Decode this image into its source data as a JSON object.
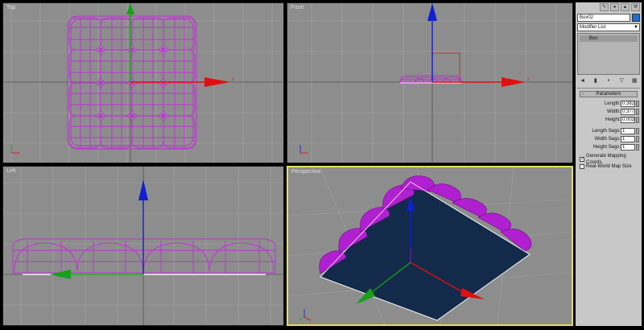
{
  "viewports": {
    "top": {
      "label": "Top"
    },
    "front": {
      "label": "Front"
    },
    "left": {
      "label": "Left"
    },
    "perspective": {
      "label": "Perspective"
    }
  },
  "axis_colors": {
    "x": "#e01010",
    "y": "#18a018",
    "z": "#1020d0"
  },
  "object_color": "#c030d8",
  "panel": {
    "object_name": "Box02",
    "object_color": "#1f6fd1",
    "modifier_list": "Modifier List",
    "stack_item": "Box",
    "rollout_title": "Parameters",
    "params": [
      {
        "label": "Length:",
        "value": "0.382m"
      },
      {
        "label": "Width:",
        "value": "0.377m"
      },
      {
        "label": "Height:",
        "value": "0.003m"
      }
    ],
    "segs": [
      {
        "label": "Length Segs:",
        "value": "1"
      },
      {
        "label": "Width Segs:",
        "value": "1"
      },
      {
        "label": "Height Segs:",
        "value": "1"
      }
    ],
    "generate_mapping": {
      "label": "Generate Mapping Coords.",
      "checked": true
    },
    "real_world": {
      "label": "Real-World Map Size",
      "checked": false
    }
  }
}
